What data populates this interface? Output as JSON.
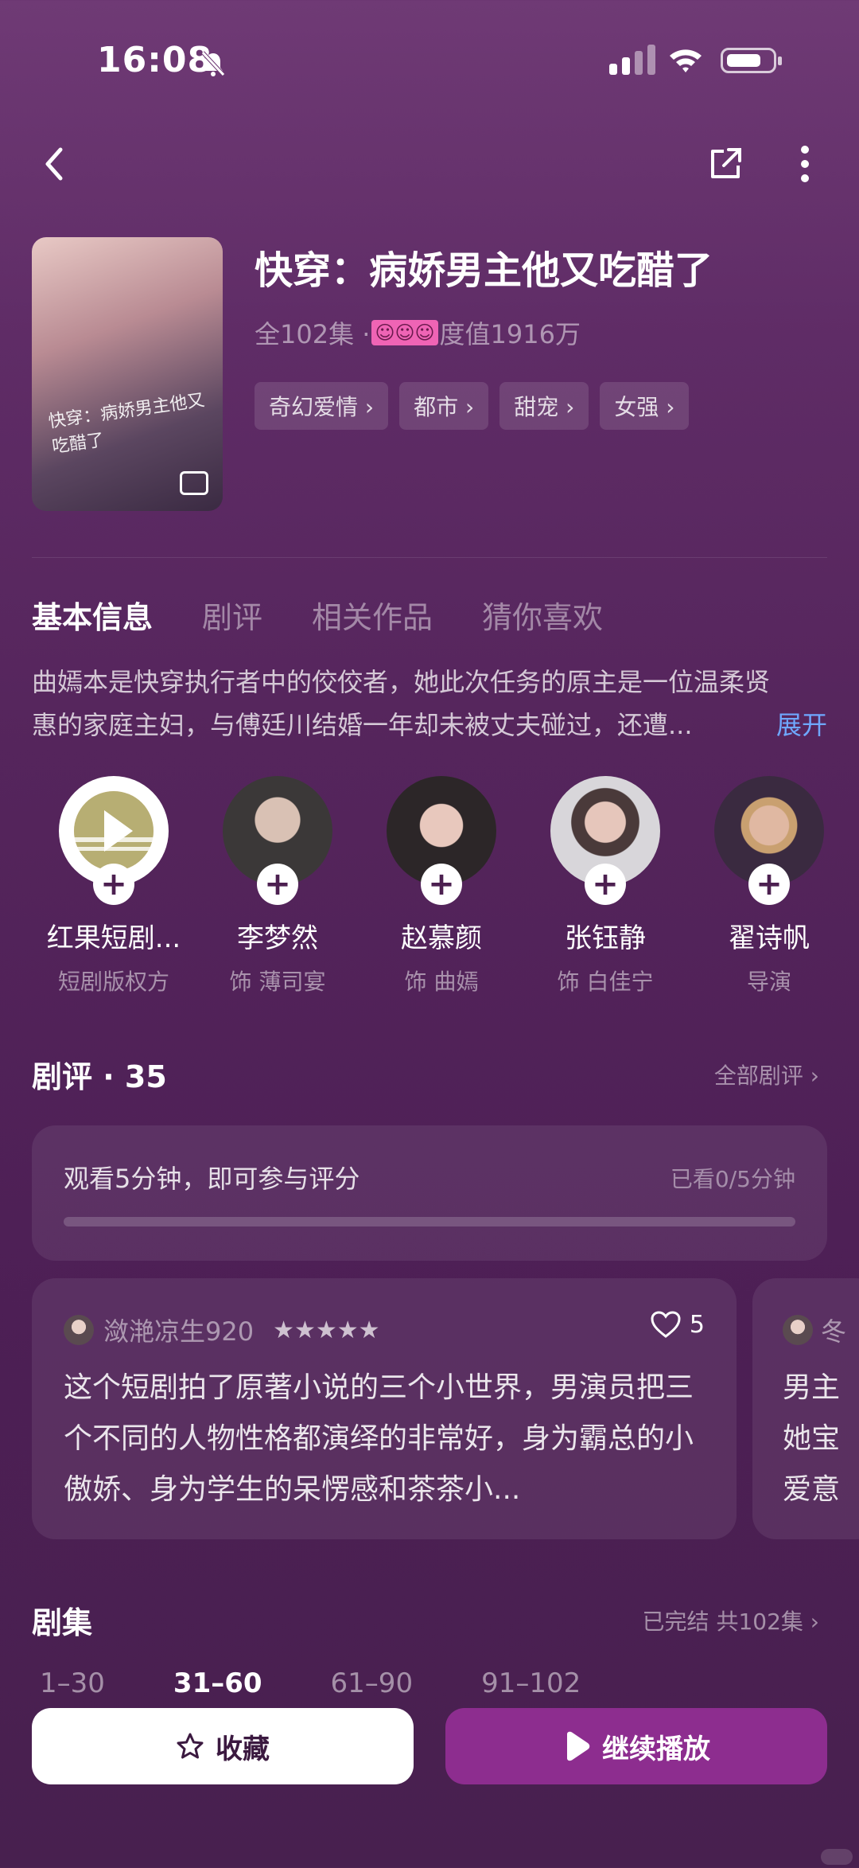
{
  "status": {
    "time": "16:08"
  },
  "show": {
    "title": "快穿：病娇男主他又吃醋了",
    "episodes_label": "全102集 · ",
    "heat_label": "度值1916万",
    "sticker": "☺☺☺",
    "poster_text": "快穿：病娇男主他又吃醋了",
    "tags": [
      "奇幻爱情 ›",
      "都市 ›",
      "甜宠 ›",
      "女强 ›"
    ]
  },
  "tabs": [
    "基本信息",
    "剧评",
    "相关作品",
    "猜你喜欢"
  ],
  "synopsis": {
    "text": "曲嫣本是快穿执行者中的佼佼者，她此次任务的原主是一位温柔贤惠的家庭主妇，与傅廷川结婚一年却未被丈夫碰过，还遭...",
    "expand": "展开"
  },
  "cast": [
    {
      "name": "红果短剧...",
      "role": "短剧版权方",
      "colors": [
        "#ffffff",
        "#f6a04d"
      ]
    },
    {
      "name": "李梦然",
      "role": "饰 薄司宴",
      "colors": [
        "#3b3838",
        "#d9c1b4"
      ]
    },
    {
      "name": "赵慕颜",
      "role": "饰 曲嫣",
      "colors": [
        "#2c2628",
        "#e8c8bd"
      ]
    },
    {
      "name": "张钰静",
      "role": "饰 白佳宁",
      "colors": [
        "#d8d6da",
        "#e6c6bb"
      ]
    },
    {
      "name": "翟诗帆",
      "role": "导演",
      "colors": [
        "#3a2a40",
        "#e0b8a2"
      ]
    }
  ],
  "reviews": {
    "title": "剧评 · 35",
    "all_link": "全部剧评 ›",
    "prompt": "观看5分钟，即可参与评分",
    "progress_label": "已看0/5分钟",
    "progress": 0,
    "items": [
      {
        "user": "潋滟凉生920",
        "stars": "★★★★★",
        "likes": "5",
        "text": "这个短剧拍了原著小说的三个小世界，男演员把三个不同的人物性格都演绎的非常好，身为霸总的小傲娇、身为学生的呆愣感和茶茶小..."
      },
      {
        "user": "冬",
        "text_lines": [
          "男主",
          "她宝",
          "爱意"
        ]
      }
    ]
  },
  "episodes": {
    "title": "剧集",
    "status": "已完结 共102集 ›",
    "ranges": [
      "1–30",
      "31–60",
      "61–90",
      "91–102"
    ],
    "active_range": 1
  },
  "actions": {
    "favorite": "收藏",
    "play": "继续播放"
  },
  "theme": {
    "accent": "#8d2d8f",
    "link": "#6fa8ff"
  }
}
